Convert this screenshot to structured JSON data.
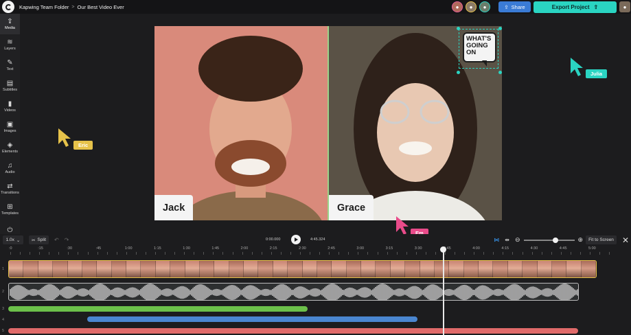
{
  "header": {
    "breadcrumb_folder": "Kapwing Team Folder",
    "breadcrumb_sep": ">",
    "project_name": "Our Best Video Ever",
    "share_label": "Share",
    "export_label": "Export Project",
    "collaborators": [
      {
        "name": "collaborator-1",
        "color": "#e95f9a"
      },
      {
        "name": "collaborator-2",
        "color": "#e6c24a"
      },
      {
        "name": "collaborator-3",
        "color": "#2ad4c2"
      }
    ]
  },
  "sidebar": {
    "items": [
      {
        "label": "Media",
        "icon": "upload-icon"
      },
      {
        "label": "Layers",
        "icon": "layers-icon"
      },
      {
        "label": "Text",
        "icon": "text-icon"
      },
      {
        "label": "Subtitles",
        "icon": "subtitles-icon"
      },
      {
        "label": "Videos",
        "icon": "film-icon"
      },
      {
        "label": "Images",
        "icon": "image-icon"
      },
      {
        "label": "Elements",
        "icon": "shapes-icon"
      },
      {
        "label": "Audio",
        "icon": "music-icon"
      },
      {
        "label": "Transitions",
        "icon": "transitions-icon"
      },
      {
        "label": "Templates",
        "icon": "grid-icon"
      },
      {
        "label": "",
        "icon": "plugins-icon"
      }
    ]
  },
  "canvas": {
    "left_name": "Jack",
    "right_name": "Grace",
    "sticker_text": "WHAT'S GOING ON"
  },
  "cursors": [
    {
      "name": "Eric",
      "color": "#e6c24a"
    },
    {
      "name": "Julia",
      "color": "#2ad4c2"
    },
    {
      "name": "Em",
      "color": "#e94b8a"
    }
  ],
  "timeline": {
    "speed": "1.0x",
    "split_label": "Split",
    "current_time": "0:00.000",
    "total_time": "4:45.324",
    "fit_label": "Fit to Screen",
    "zoom_level": 0.64,
    "ruler": [
      ":0",
      ":15",
      ":30",
      ":45",
      "1:00",
      "1:15",
      "1:30",
      "1:45",
      "2:00",
      "2:15",
      "2:30",
      "2:45",
      "3:00",
      "3:15",
      "3:30",
      "3:45",
      "4:00",
      "4:15",
      "4:30",
      "4:45",
      "5:00"
    ],
    "track_numbers": [
      "1",
      "2",
      "3",
      "4",
      "5"
    ],
    "track_colors": {
      "video_border": "#e6c24a",
      "green": "#6cc04a",
      "blue": "#4a86d0",
      "red": "#e06a6a"
    }
  }
}
